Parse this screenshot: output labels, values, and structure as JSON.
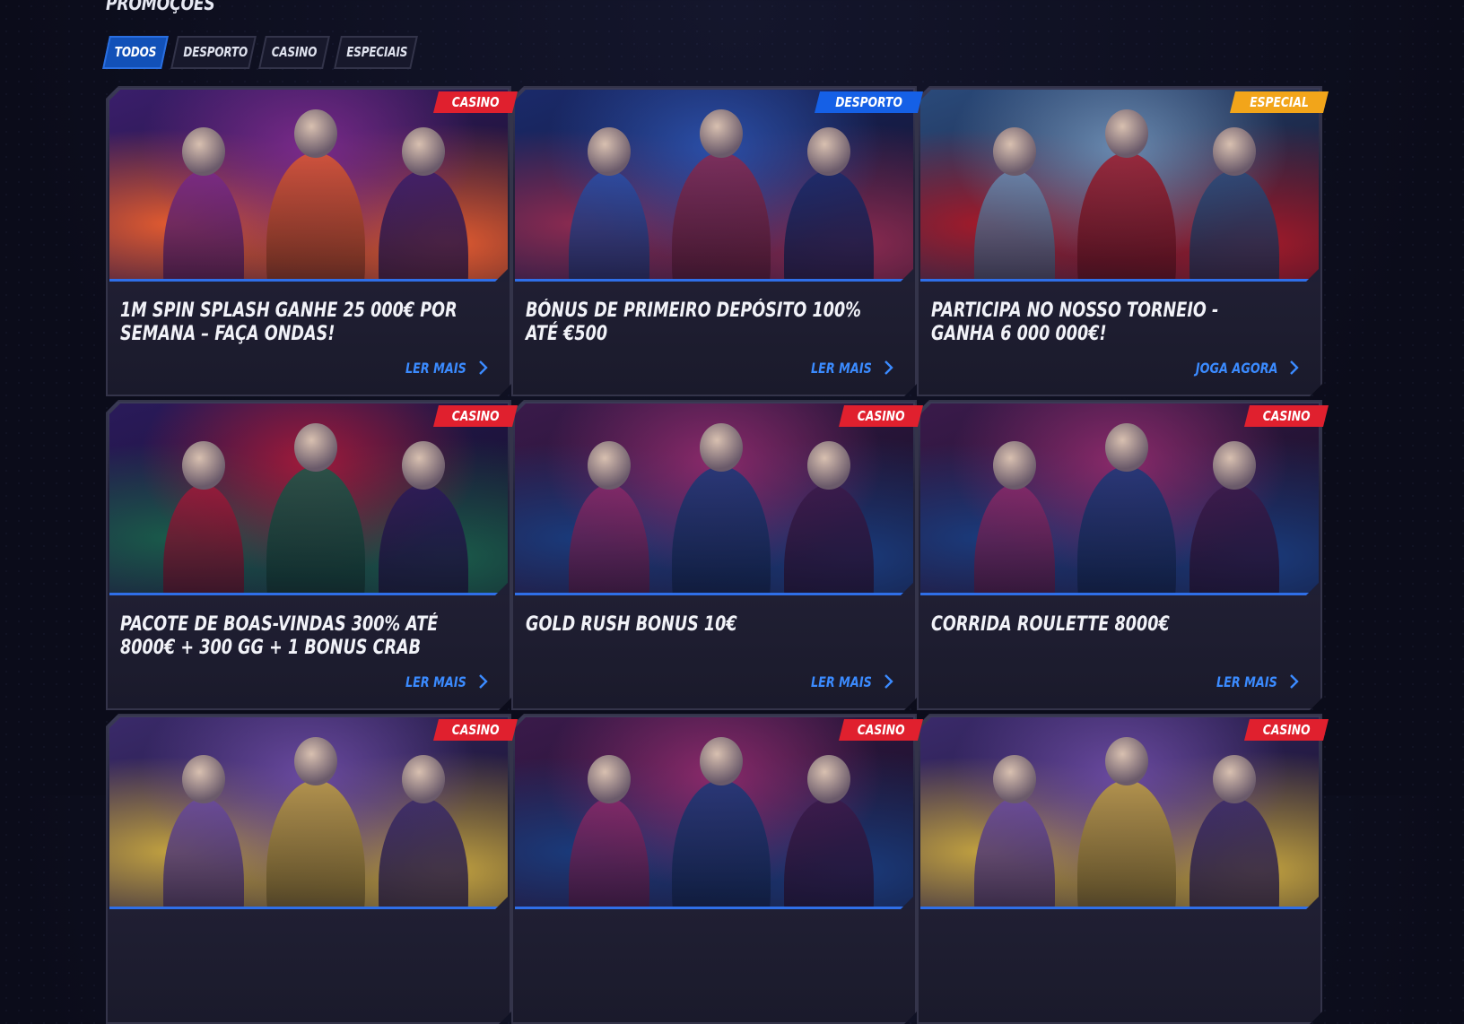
{
  "page": {
    "title": "PROMOÇÕES"
  },
  "tabs": [
    {
      "label": "TODOS",
      "active": true
    },
    {
      "label": "DESPORTO",
      "active": false
    },
    {
      "label": "CASINO",
      "active": false
    },
    {
      "label": "ESPECIAIS",
      "active": false
    }
  ],
  "cards": [
    {
      "badge": "CASINO",
      "badge_type": "casino",
      "title": "1M SPIN SPLASH GANHE 25 000€ POR SEMANA – FAÇA ONDAS!",
      "link": "LER MAIS",
      "image": "three-women-beach-illustration",
      "palette": [
        "#3a1e6b",
        "#7a2a8a",
        "#e05a30"
      ]
    },
    {
      "badge": "DESPORTO",
      "badge_type": "desporto",
      "title": "BÓNUS DE PRIMEIRO DEPÓSITO 100% ATÉ €500",
      "link": "LER MAIS",
      "image": "wolf-bear-football-illustration",
      "palette": [
        "#1a2a6a",
        "#2b4fa8",
        "#8a2a50"
      ]
    },
    {
      "badge": "ESPECIAL",
      "badge_type": "especial",
      "title": "PARTICIPA NO NOSSO TORNEIO - GANHA 6 000 000€!",
      "link": "JOGA AGORA",
      "image": "fox-supercars-illustration",
      "palette": [
        "#2a4a7a",
        "#6a8ab0",
        "#a01a2a"
      ]
    },
    {
      "badge": "CASINO",
      "badge_type": "casino",
      "title": "PACOTE DE BOAS-VINDAS 300% ATÉ 8000€ + 300 GG + 1 BONUS CRAB",
      "link": "LER MAIS",
      "image": "wolf-poker-table-illustration",
      "palette": [
        "#2a1a5a",
        "#a01a3a",
        "#1a5a4a"
      ]
    },
    {
      "badge": "CASINO",
      "badge_type": "casino",
      "title": "GOLD RUSH BONUS 10€",
      "link": "LER MAIS",
      "image": "bears-slot-machines-illustration",
      "palette": [
        "#3a1a4a",
        "#8a2a6a",
        "#1a3a7a"
      ]
    },
    {
      "badge": "CASINO",
      "badge_type": "casino",
      "title": "CORRIDA ROULETTE 8000€",
      "link": "LER MAIS",
      "image": "bears-slot-machines-illustration",
      "palette": [
        "#3a1a4a",
        "#8a2a6a",
        "#1a3a7a"
      ]
    },
    {
      "badge": "CASINO",
      "badge_type": "casino",
      "title": "",
      "link": "",
      "image": "money-slot-illustration",
      "palette": [
        "#3a2a6a",
        "#6a4aa0",
        "#c0a040"
      ]
    },
    {
      "badge": "CASINO",
      "badge_type": "casino",
      "title": "",
      "link": "",
      "image": "bears-slot-machines-illustration",
      "palette": [
        "#3a1a4a",
        "#8a2a6a",
        "#1a3a7a"
      ]
    },
    {
      "badge": "CASINO",
      "badge_type": "casino",
      "title": "",
      "link": "",
      "image": "money-slot-illustration",
      "palette": [
        "#3a2a6a",
        "#6a4aa0",
        "#c0a040"
      ]
    }
  ]
}
